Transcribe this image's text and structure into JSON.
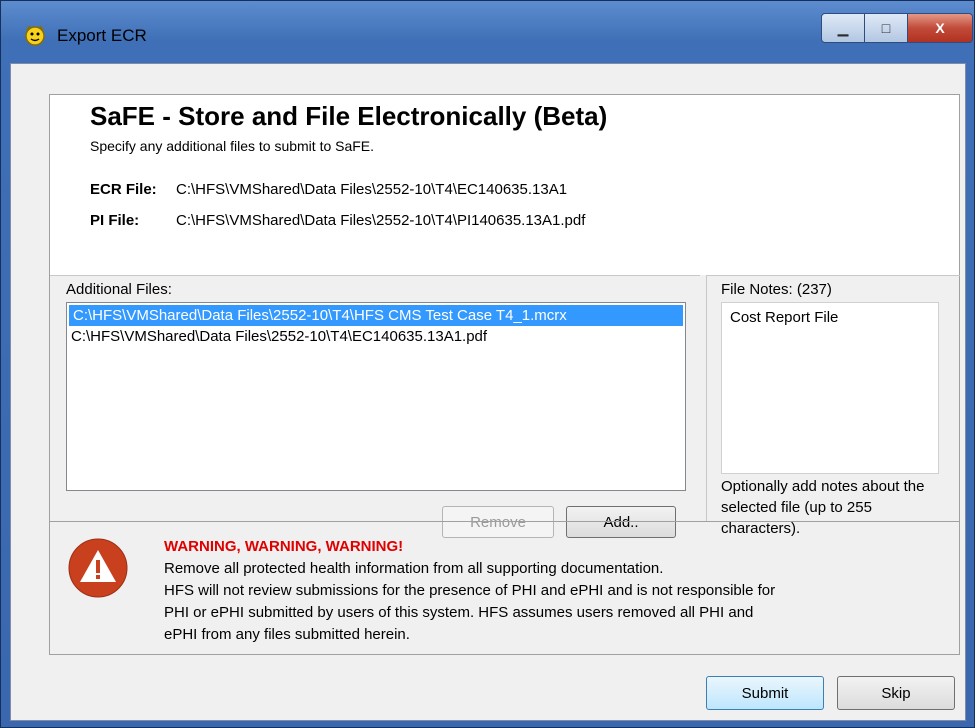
{
  "window": {
    "title": "Export ECR",
    "minimize_glyph": "▁",
    "maximize_glyph": "□",
    "close_glyph": "X"
  },
  "header": {
    "title": "SaFE - Store and File Electronically (Beta)",
    "subtitle": "Specify any additional files to submit to SaFE.",
    "ecr_label": "ECR File:",
    "ecr_value": "C:\\HFS\\VMShared\\Data Files\\2552-10\\T4\\EC140635.13A1",
    "pi_label": "PI File:",
    "pi_value": "C:\\HFS\\VMShared\\Data Files\\2552-10\\T4\\PI140635.13A1.pdf"
  },
  "additional_files": {
    "label": "Additional Files:",
    "items": [
      {
        "path": "C:\\HFS\\VMShared\\Data Files\\2552-10\\T4\\HFS CMS Test Case T4_1.mcrx",
        "selected": true
      },
      {
        "path": "C:\\HFS\\VMShared\\Data Files\\2552-10\\T4\\EC140635.13A1.pdf",
        "selected": false
      }
    ],
    "remove_label": "Remove",
    "add_label": "Add.."
  },
  "file_notes": {
    "label": "File Notes: (237)",
    "value": "Cost Report File",
    "help": "Optionally add notes about the selected file (up to 255 characters)."
  },
  "warning": {
    "icon": "warning-icon",
    "title": "WARNING, WARNING, WARNING!",
    "lines": [
      "Remove all protected health information from all supporting documentation.",
      "HFS will not review submissions for the presence of PHI and ePHI and is not responsible for",
      "PHI or ePHI submitted by users of this system.  HFS assumes users removed all PHI and",
      "ePHI from any files submitted herein."
    ]
  },
  "footer": {
    "submit_label": "Submit",
    "skip_label": "Skip"
  },
  "colors": {
    "selection": "#3399ff",
    "warning_text": "#e00000",
    "warning_icon": "#c8401e"
  }
}
